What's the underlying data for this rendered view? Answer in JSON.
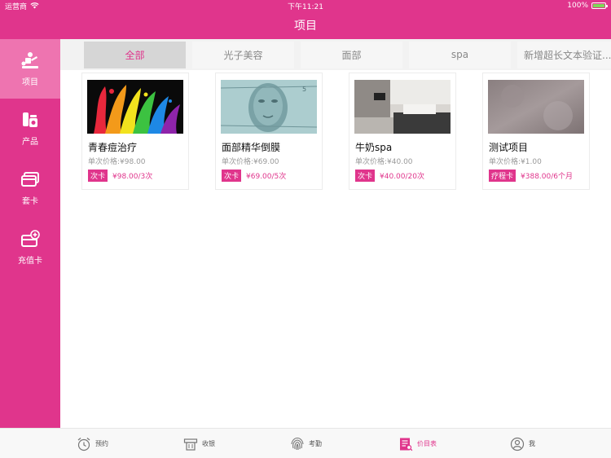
{
  "status_bar": {
    "carrier": "运营商",
    "time": "下午11:21",
    "battery": "100%"
  },
  "nav": {
    "title": "项目"
  },
  "sidebar": {
    "items": [
      {
        "label": "项目",
        "icon": "massage-icon",
        "active": true
      },
      {
        "label": "产品",
        "icon": "products-icon",
        "active": false
      },
      {
        "label": "套卡",
        "icon": "card-set-icon",
        "active": false
      },
      {
        "label": "充值卡",
        "icon": "recharge-card-icon",
        "active": false
      }
    ]
  },
  "tabs": [
    {
      "label": "全部",
      "active": true
    },
    {
      "label": "光子美容",
      "active": false
    },
    {
      "label": "面部",
      "active": false
    },
    {
      "label": "spa",
      "active": false
    },
    {
      "label": "新增超长文本验证...",
      "active": false
    }
  ],
  "cards": [
    {
      "name": "青春痘治疗",
      "price": "单次价格:¥98.00",
      "badge": "次卡",
      "card_price": "¥98.00/3次"
    },
    {
      "name": "面部精华倒膜",
      "price": "单次价格:¥69.00",
      "badge": "次卡",
      "card_price": "¥69.00/5次"
    },
    {
      "name": "牛奶spa",
      "price": "单次价格:¥40.00",
      "badge": "次卡",
      "card_price": "¥40.00/20次"
    },
    {
      "name": "测试项目",
      "price": "单次价格:¥1.00",
      "badge": "疗程卡",
      "card_price": "¥388.00/6个月"
    }
  ],
  "tabbar": {
    "items": [
      {
        "label": "预约",
        "icon": "alarm-clock-icon"
      },
      {
        "label": "收银",
        "icon": "cashier-icon"
      },
      {
        "label": "考勤",
        "icon": "fingerprint-icon"
      },
      {
        "label": "价目表",
        "icon": "price-list-icon",
        "active": true
      },
      {
        "label": "我",
        "icon": "user-icon"
      }
    ]
  },
  "colors": {
    "brand": "#e0358c",
    "sidebar_active": "#ee74b0",
    "battery": "#7ed957"
  }
}
